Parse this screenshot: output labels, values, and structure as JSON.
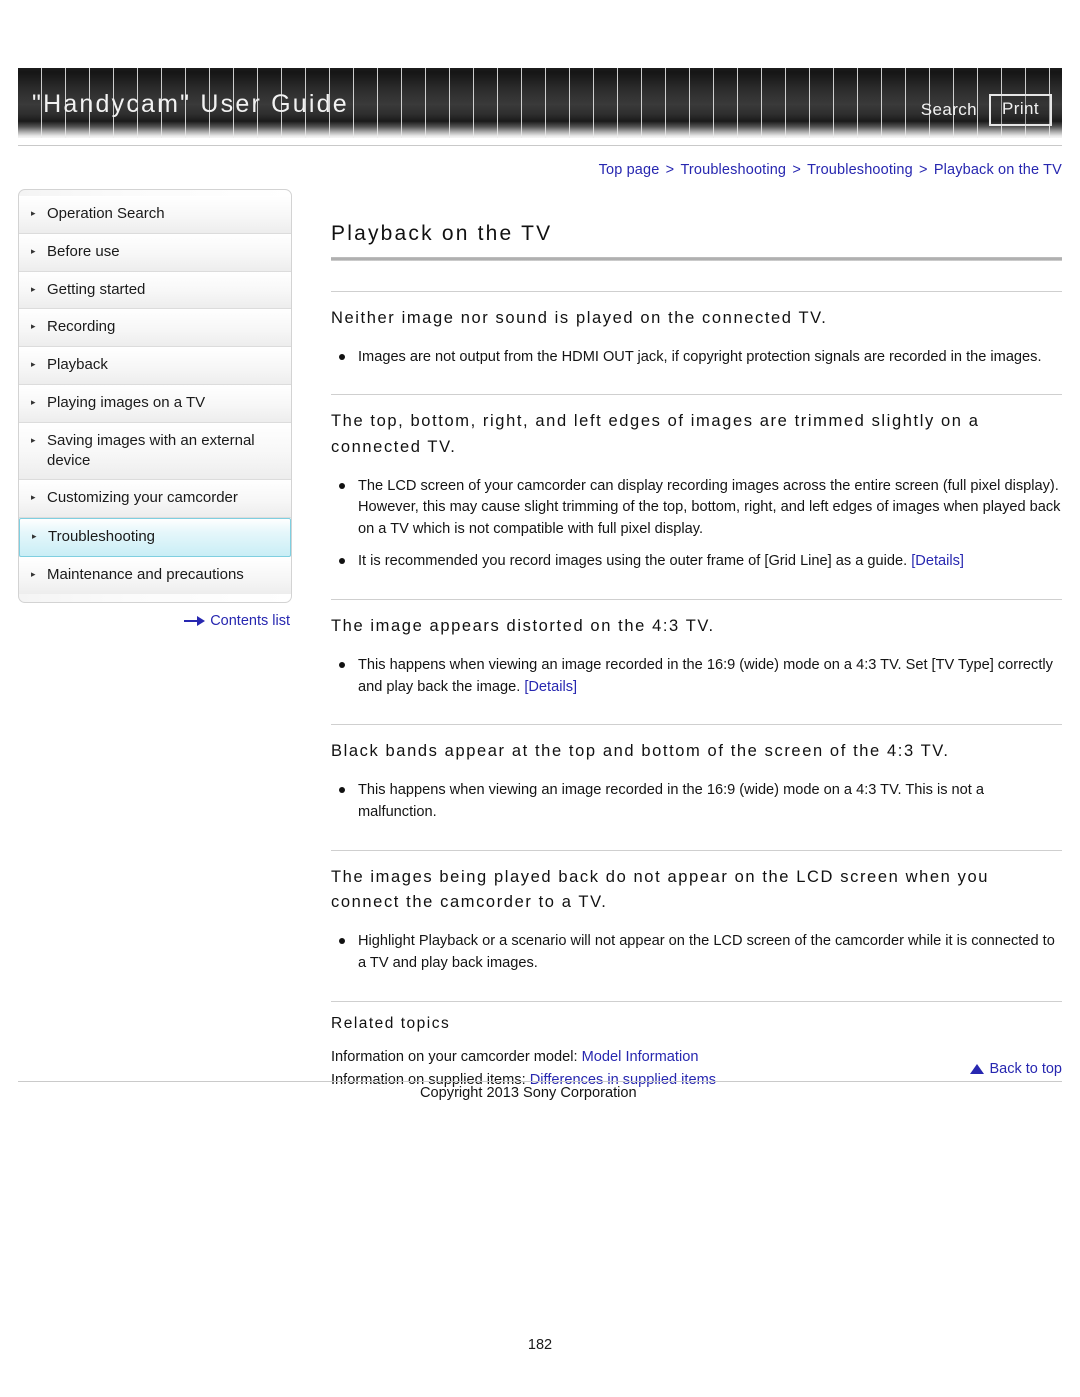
{
  "header": {
    "title": "\"Handycam\" User Guide",
    "search_label": "Search",
    "print_label": "Print"
  },
  "breadcrumb": {
    "items": [
      "Top page",
      "Troubleshooting",
      "Troubleshooting",
      "Playback on the TV"
    ],
    "separator": ">"
  },
  "sidebar": {
    "items": [
      {
        "label": "Operation Search",
        "active": false
      },
      {
        "label": "Before use",
        "active": false
      },
      {
        "label": "Getting started",
        "active": false
      },
      {
        "label": "Recording",
        "active": false
      },
      {
        "label": "Playback",
        "active": false
      },
      {
        "label": "Playing images on a TV",
        "active": false
      },
      {
        "label": "Saving images with an external device",
        "active": false
      },
      {
        "label": "Customizing your camcorder",
        "active": false
      },
      {
        "label": "Troubleshooting",
        "active": true
      },
      {
        "label": "Maintenance and precautions",
        "active": false
      }
    ],
    "contents_list_label": "Contents list",
    "bullet_glyph": "▸"
  },
  "main": {
    "page_title": "Playback on the TV",
    "sections": [
      {
        "heading": "Neither image nor sound is played on the connected TV.",
        "bullets": [
          {
            "text": "Images are not output from the HDMI OUT jack, if copyright protection signals are recorded in the images.",
            "link": ""
          }
        ]
      },
      {
        "heading": "The top, bottom, right, and left edges of images are trimmed slightly on a connected TV.",
        "bullets": [
          {
            "text": "The LCD screen of your camcorder can display recording images across the entire screen (full pixel display). However, this may cause slight trimming of the top, bottom, right, and left edges of images when played back on a TV which is not compatible with full pixel display.",
            "link": ""
          },
          {
            "text": "It is recommended you record images using the outer frame of [Grid Line] as a guide.",
            "link": "[Details]"
          }
        ]
      },
      {
        "heading": "The image appears distorted on the 4:3 TV.",
        "bullets": [
          {
            "text": "This happens when viewing an image recorded in the 16:9 (wide) mode on a 4:3 TV. Set [TV Type] correctly and play back the image.",
            "link": "[Details]"
          }
        ]
      },
      {
        "heading": "Black bands appear at the top and bottom of the screen of the 4:3 TV.",
        "bullets": [
          {
            "text": "This happens when viewing an image recorded in the 16:9 (wide) mode on a 4:3 TV. This is not a malfunction.",
            "link": ""
          }
        ]
      },
      {
        "heading": "The images being played back do not appear on the LCD screen when you connect the camcorder to a TV.",
        "bullets": [
          {
            "text": "Highlight Playback or a scenario will not appear on the LCD screen of the camcorder while it is connected to a TV and play back images.",
            "link": ""
          }
        ]
      }
    ],
    "related": {
      "title": "Related topics",
      "lines": [
        {
          "prefix": "Information on your camcorder model: ",
          "link": "Model Information"
        },
        {
          "prefix": "Information on supplied items: ",
          "link": "Differences in supplied items"
        }
      ]
    }
  },
  "footer": {
    "back_to_top_label": "Back to top",
    "copyright": "Copyright 2013 Sony Corporation",
    "page_number": "182"
  },
  "colors": {
    "link": "#2727b0",
    "active_nav_bg": "#c9eef6",
    "active_nav_border": "#7fcfe0",
    "header_dark": "#1d1d1d"
  }
}
